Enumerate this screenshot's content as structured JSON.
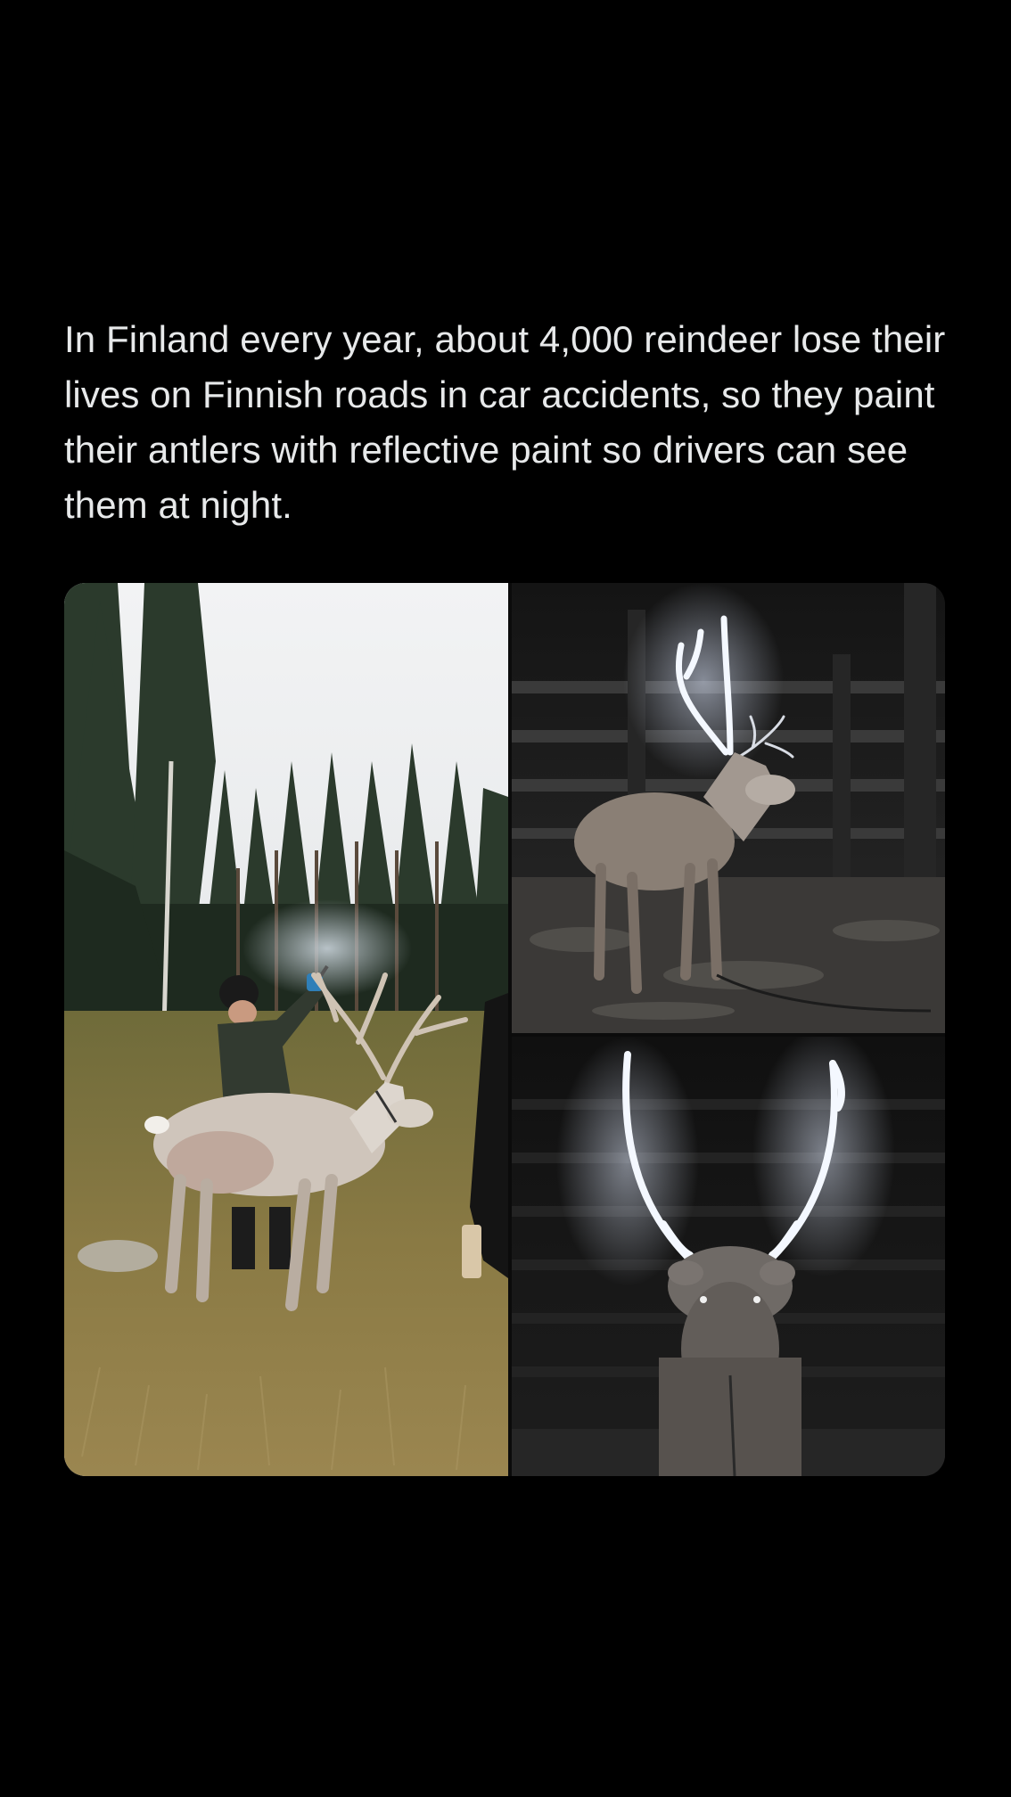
{
  "post": {
    "text": "In Finland every year, about 4,000 reindeer lose their lives on Finnish roads in car accidents, so they paint their antlers with reflective paint so drivers can see them at night."
  },
  "media": {
    "photos": [
      {
        "subject": "reindeer-daytime-painting-photo"
      },
      {
        "subject": "reindeer-night-side-photo"
      },
      {
        "subject": "reindeer-night-front-photo"
      }
    ]
  },
  "colors": {
    "background": "#000000",
    "text": "#e7e9ea",
    "reflective_antler": "#f4f8ff"
  }
}
